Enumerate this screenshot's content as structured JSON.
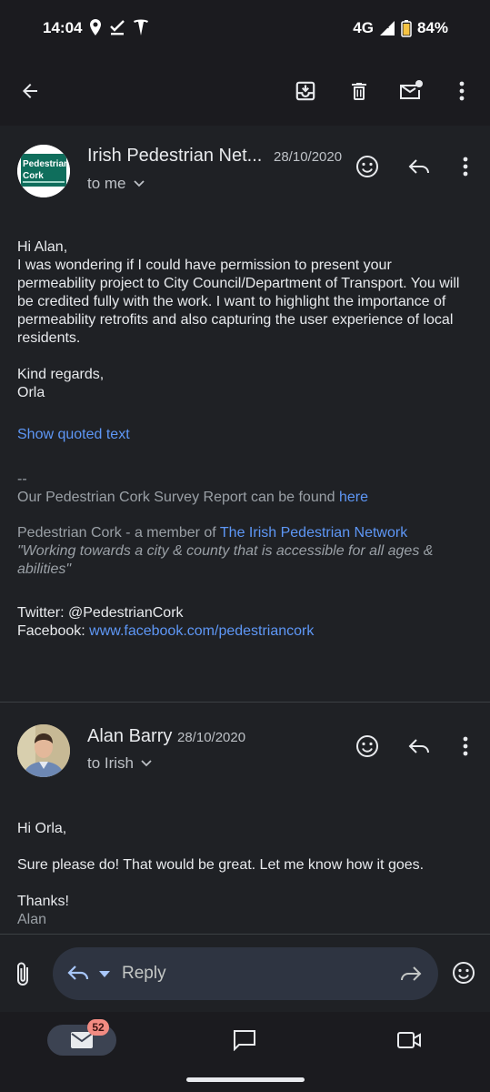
{
  "status_bar": {
    "time": "14:04",
    "network": "4G",
    "battery": "84%"
  },
  "toolbar": {
    "icons": [
      "back-arrow-icon",
      "archive-icon",
      "delete-icon",
      "mark-unread-icon",
      "more-vert-icon"
    ]
  },
  "messages": [
    {
      "avatar_text_1": "Pedestrian",
      "avatar_text_2": "Cork",
      "sender": "Irish Pedestrian Net...",
      "date": "28/10/2020",
      "recipient": "to me",
      "greeting": "Hi Alan,",
      "paragraph": "I was wondering if I could have permission to present your permeability project to City Council/Department of Transport. You will be credited fully with the work. I want to highlight the importance of permeability retrofits and also capturing the user experience of local residents.",
      "closing": "Kind regards,",
      "name": "Orla",
      "show_quoted": "Show quoted text",
      "sig_dash": "--",
      "sig_survey": "Our Pedestrian Cork Survey Report can be found ",
      "sig_survey_link": "here",
      "sig_member": "Pedestrian Cork - a member of ",
      "sig_member_link": "The Irish Pedestrian Network",
      "sig_quote": "\"Working towards a city & county that is accessible for all ages & abilities\"",
      "twitter": "Twitter: @PedestrianCork",
      "facebook_label": "Facebook: ",
      "facebook_link": "www.facebook.com/pedestriancork"
    },
    {
      "sender": "Alan Barry",
      "date": "28/10/2020",
      "recipient": "to Irish",
      "greeting": "Hi Orla,",
      "paragraph": "Sure please do! That would be great. Let me know how it goes.",
      "closing": "Thanks!",
      "name": "Alan"
    }
  ],
  "reply_bar": {
    "reply_label": "Reply"
  },
  "bottom_nav": {
    "mail_badge": "52"
  },
  "colors": {
    "link": "#5e97f6",
    "background": "#1f2125",
    "badge": "#f28b82"
  }
}
